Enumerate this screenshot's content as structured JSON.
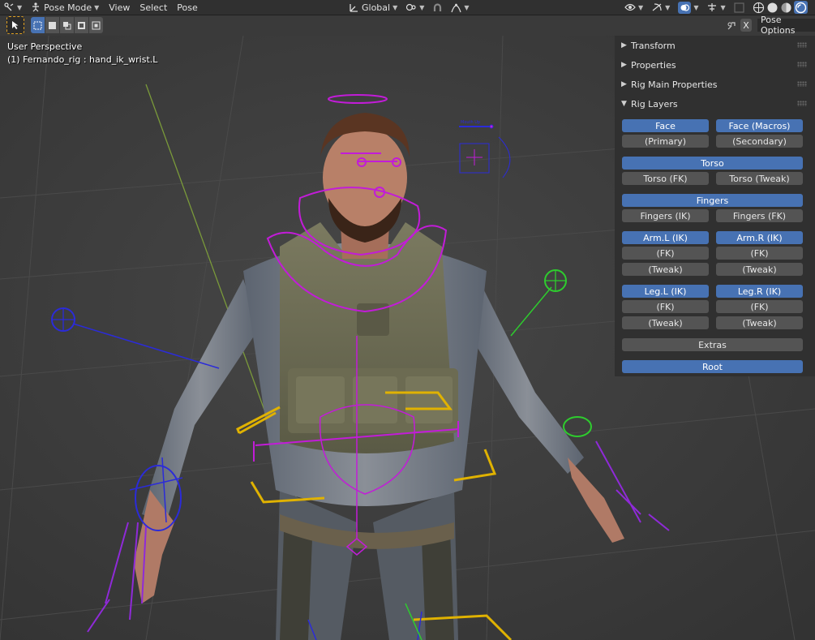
{
  "header": {
    "mode_label": "Pose Mode",
    "menus": [
      "View",
      "Select",
      "Pose"
    ],
    "transform_orientation": "Global"
  },
  "toolbar": {
    "pose_options_label": "Pose Options",
    "x_label": "X"
  },
  "viewport": {
    "perspective_label": "User Perspective",
    "active_object_label": "(1) Fernando_rig : hand_ik_wrist.L"
  },
  "sidebar": {
    "panels": [
      {
        "label": "Transform",
        "expanded": false
      },
      {
        "label": "Properties",
        "expanded": false
      },
      {
        "label": "Rig Main Properties",
        "expanded": false
      },
      {
        "label": "Rig Layers",
        "expanded": true
      }
    ],
    "rig_layers": {
      "face": "Face",
      "face_macros": "Face (Macros)",
      "primary": "(Primary)",
      "secondary": "(Secondary)",
      "torso": "Torso",
      "torso_fk": "Torso (FK)",
      "torso_tweak": "Torso (Tweak)",
      "fingers": "Fingers",
      "fingers_ik": "Fingers (IK)",
      "fingers_fk": "Fingers (FK)",
      "arm_l_ik": "Arm.L (IK)",
      "arm_r_ik": "Arm.R (IK)",
      "arm_l_fk": "(FK)",
      "arm_r_fk": "(FK)",
      "arm_l_tweak": "(Tweak)",
      "arm_r_tweak": "(Tweak)",
      "leg_l_ik": "Leg.L (IK)",
      "leg_r_ik": "Leg.R (IK)",
      "leg_l_fk": "(FK)",
      "leg_r_fk": "(FK)",
      "leg_l_tweak": "(Tweak)",
      "leg_r_tweak": "(Tweak)",
      "extras": "Extras",
      "root": "Root"
    }
  },
  "colors": {
    "accent": "#4772b3",
    "bone_magenta": "#c21cd8",
    "bone_blue": "#2b2bd9",
    "bone_yellow": "#e0b200",
    "bone_green": "#2ecc2e"
  }
}
